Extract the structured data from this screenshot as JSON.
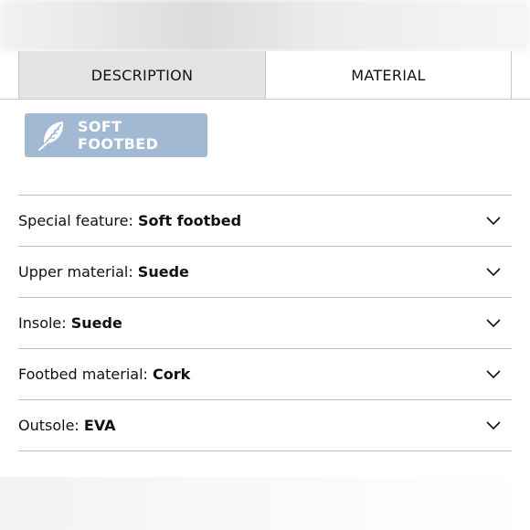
{
  "tabs": [
    {
      "label": "DESCRIPTION",
      "active": false
    },
    {
      "label": "MATERIAL",
      "active": true
    }
  ],
  "feature_badge": {
    "label": "SOFT FOOTBED",
    "icon": "feather-icon",
    "color": "#a2b9d4"
  },
  "attributes": [
    {
      "label": "Special feature:",
      "value": "Soft footbed"
    },
    {
      "label": "Upper material:",
      "value": "Suede"
    },
    {
      "label": "Insole:",
      "value": "Suede"
    },
    {
      "label": "Footbed material:",
      "value": "Cork"
    },
    {
      "label": "Outsole:",
      "value": "EVA"
    }
  ]
}
